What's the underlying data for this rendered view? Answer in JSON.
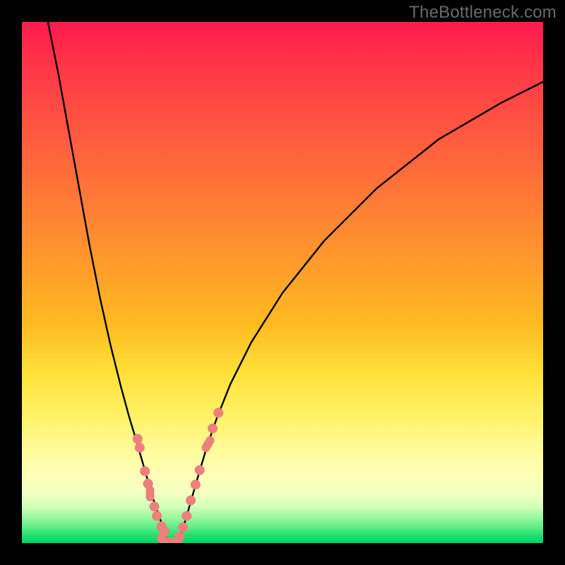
{
  "attribution": "TheBottleneck.com",
  "colors": {
    "frame_bg": "#000000",
    "curve_stroke": "#000000",
    "marker_fill": "#ee7f7a",
    "marker_stroke": "#e76c68",
    "grad_top": "#ff1a4d",
    "grad_mid": "#ffe33a",
    "grad_bot": "#00d55f"
  },
  "chart_data": {
    "type": "line",
    "title": "",
    "xlabel": "",
    "ylabel": "",
    "xlim": [
      0,
      100
    ],
    "ylim": [
      0,
      100
    ],
    "series": [
      {
        "name": "left-curve",
        "x": [
          5,
          7,
          9,
          11,
          13,
          15,
          17,
          19,
          20.5,
          22,
          23.3,
          24.3,
          25,
          25.7,
          26.4,
          27,
          27.5,
          28
        ],
        "y": [
          100,
          90,
          79,
          68,
          57,
          47,
          38,
          30,
          24.5,
          19.5,
          15,
          11.5,
          9,
          7,
          5,
          3.2,
          1.6,
          0
        ]
      },
      {
        "name": "right-curve",
        "x": [
          30,
          30.8,
          31.7,
          32.7,
          34,
          35.5,
          37.4,
          40,
          44,
          50,
          58,
          68,
          80,
          92,
          100
        ],
        "y": [
          0,
          2.5,
          5.5,
          9,
          13.5,
          18.5,
          24,
          30.5,
          38.5,
          48,
          58,
          68,
          77.5,
          84.5,
          88.5
        ]
      }
    ],
    "markers": [
      {
        "x": 22.2,
        "y": 20.0,
        "shape": "round"
      },
      {
        "x": 22.6,
        "y": 18.3,
        "shape": "round"
      },
      {
        "x": 23.6,
        "y": 13.8,
        "shape": "round"
      },
      {
        "x": 24.2,
        "y": 11.4,
        "shape": "round"
      },
      {
        "x": 24.6,
        "y": 9.5,
        "shape": "pill-v"
      },
      {
        "x": 25.4,
        "y": 7.0,
        "shape": "round"
      },
      {
        "x": 25.9,
        "y": 5.2,
        "shape": "round"
      },
      {
        "x": 26.8,
        "y": 3.2,
        "shape": "round"
      },
      {
        "x": 27.1,
        "y": 1.6,
        "shape": "pill-d"
      },
      {
        "x": 28.0,
        "y": 0.2,
        "shape": "pill-h"
      },
      {
        "x": 29.3,
        "y": 0.2,
        "shape": "pill-h"
      },
      {
        "x": 30.2,
        "y": 1.2,
        "shape": "round"
      },
      {
        "x": 30.9,
        "y": 3.0,
        "shape": "round"
      },
      {
        "x": 31.6,
        "y": 5.2,
        "shape": "round"
      },
      {
        "x": 32.4,
        "y": 8.2,
        "shape": "round"
      },
      {
        "x": 33.3,
        "y": 11.2,
        "shape": "round"
      },
      {
        "x": 34.1,
        "y": 14.0,
        "shape": "round"
      },
      {
        "x": 35.7,
        "y": 19.0,
        "shape": "pill-d"
      },
      {
        "x": 36.6,
        "y": 22.0,
        "shape": "round"
      },
      {
        "x": 37.7,
        "y": 25.0,
        "shape": "round"
      }
    ],
    "legend": null,
    "grid": false,
    "notes": "Background is a vertical hue gradient from red (top) through orange/yellow to green (bottom). Curves form a V with minimum near x≈28–30. Salmon-colored marker blobs cluster along both curve legs in the lower ~25% band. No axis ticks, labels, or legend are visible."
  }
}
